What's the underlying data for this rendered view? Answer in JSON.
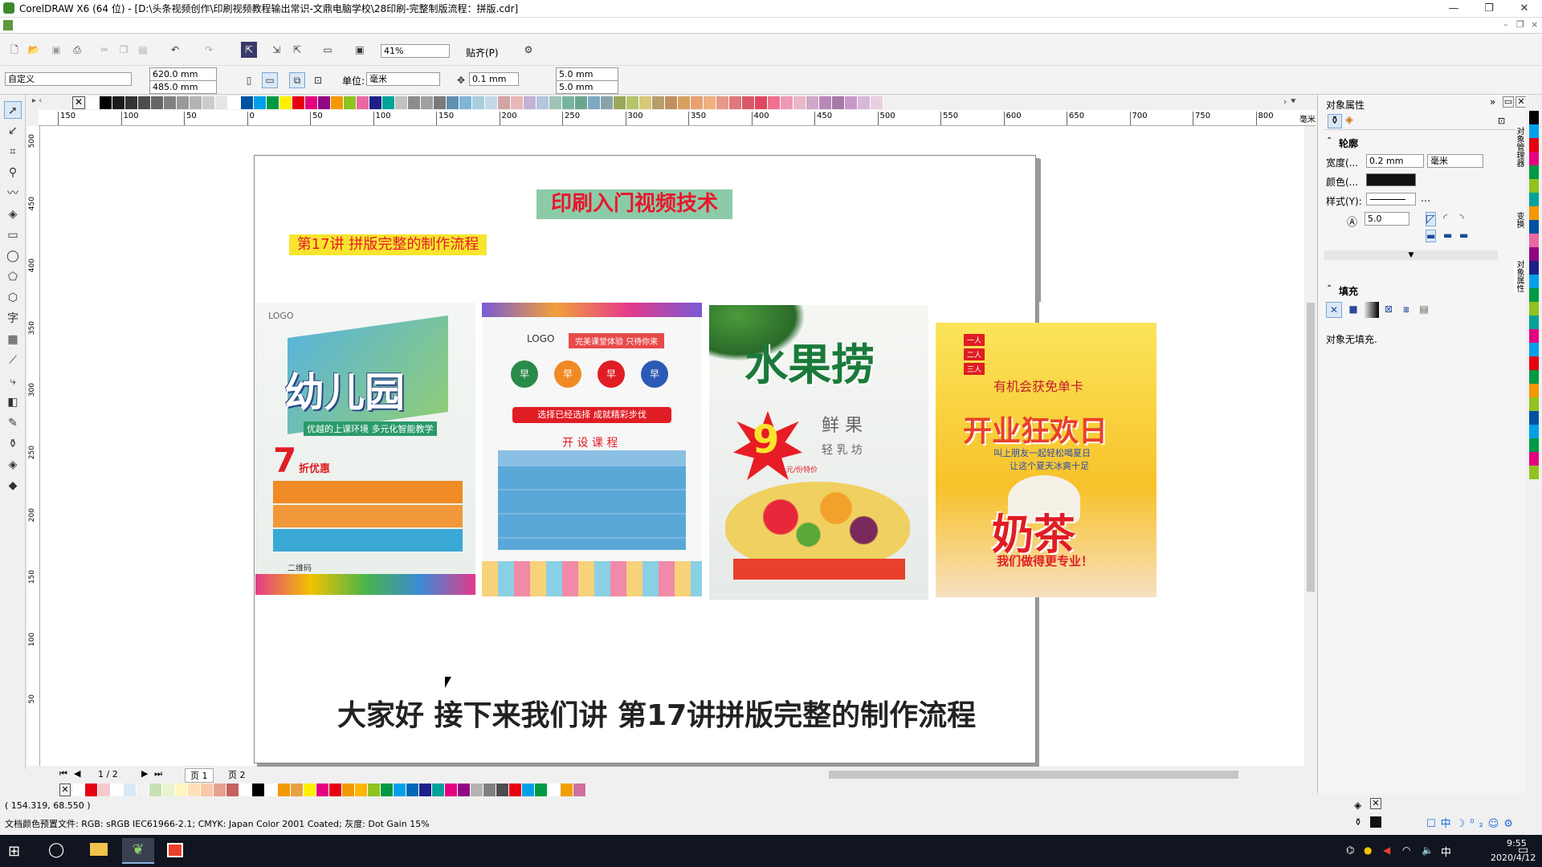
{
  "app": {
    "title": "CorelDRAW X6 (64 位) - [D:\\头条视频创作\\印刷视频教程输出常识-文鼎电脑学校\\28印刷-完整制版流程：拼版.cdr]",
    "window_controls": [
      "—",
      "❐",
      "✕"
    ],
    "doc_controls": [
      "–",
      "❐",
      "×"
    ]
  },
  "toolbar": {
    "zoom": "41%",
    "snap_label": "贴齐(P)",
    "preset": "自定义",
    "page_width": "620.0 mm",
    "page_height": "485.0 mm",
    "units_label": "单位:",
    "units_value": "毫米",
    "nudge": "0.1 mm",
    "dup_x": "5.0 mm",
    "dup_y": "5.0 mm"
  },
  "ruler": {
    "h_ticks": [
      "150",
      "100",
      "50",
      "0",
      "50",
      "100",
      "150",
      "200",
      "250",
      "300",
      "350",
      "400",
      "450",
      "500",
      "550",
      "600",
      "650",
      "700",
      "750",
      "800"
    ],
    "h_unit": "毫米",
    "v_ticks": [
      "500",
      "450",
      "400",
      "350",
      "300",
      "250",
      "200",
      "150",
      "100",
      "50"
    ]
  },
  "canvas": {
    "heading": "印刷入门视频技术",
    "subheading": "第17讲 拼版完整的制作流程",
    "subtitle": "大家好  接下来我们讲  第17讲拼版完整的制作流程"
  },
  "posters": [
    {
      "name": "kindergarten",
      "title": "幼儿园",
      "logo": "LOGO",
      "slogan": "优越的上课环境 多元化智能教学",
      "discount": "7",
      "discount_label": "折优惠",
      "footer": "二维码"
    },
    {
      "name": "course",
      "logo": "LOGO",
      "banner": "完美课堂体验 只待你来",
      "circles": [
        "早",
        "早",
        "早",
        "早"
      ],
      "cta": "选择已经选择 成就精彩步伐",
      "section": "开 设 课 程"
    },
    {
      "name": "fruit",
      "title": "水果捞",
      "badge": "9",
      "badge_unit": "元/份特价",
      "sub1": "鲜 果",
      "sub2": "轻 乳 坊"
    },
    {
      "name": "milktea",
      "offers": [
        "一人",
        "二人",
        "三人"
      ],
      "line": "有机会获免单卡",
      "title": "开业狂欢日",
      "sub": "叫上朋友一起轻松喝夏日",
      "sub2": "让这个夏天冰爽十足",
      "brand": "奶茶",
      "slogan": "我们做得更专业！"
    }
  ],
  "page_nav": {
    "count": "1 / 2",
    "tabs": [
      "页 1",
      "页 2"
    ]
  },
  "docker": {
    "title": "对象属性",
    "outline_section": "轮廓",
    "width_label": "宽度(...",
    "width_value": "0.2 mm",
    "unit_value": "毫米",
    "color_label": "颜色(...",
    "style_label": "样式(Y):",
    "miter_value": "5.0",
    "fill_section": "填充",
    "no_fill": "对象无填充.",
    "side_tabs": [
      "对象管理器",
      "变换",
      "对象属性"
    ]
  },
  "status": {
    "coords": "( 154.319, 68.550 )",
    "color_profile": "文档颜色预置文件: RGB: sRGB IEC61966-2.1; CMYK: Japan Color 2001 Coated; 灰度: Dot Gain 15%"
  },
  "taskbar": {
    "time": "9:55",
    "date": "2020/4/12",
    "tray": [
      "中",
      "ɡ",
      "⛢"
    ]
  },
  "palette": {
    "top": [
      "#ffffff",
      "#000000",
      "#1a1a1a",
      "#333333",
      "#4d4d4d",
      "#666666",
      "#808080",
      "#999999",
      "#b3b3b3",
      "#cccccc",
      "#e6e6e6",
      "#ffffff",
      "#0051a2",
      "#00a0e9",
      "#009944",
      "#fff100",
      "#e60012",
      "#e4007f",
      "#920783",
      "#f39800",
      "#8fc31f",
      "#ea68a2",
      "#1d2088",
      "#00a29a",
      "#c0c0c0",
      "#8c8c8c",
      "#a0a0a0",
      "#7a7a7a",
      "#5f8fb0",
      "#7fb5d5",
      "#a8cde0",
      "#c4d8e8",
      "#d1a3a4",
      "#e8b7b7",
      "#c1b2d6",
      "#b4c5e0",
      "#9fc5b6",
      "#77b4a0",
      "#6aa590",
      "#7ea9c2",
      "#8aa3a8",
      "#9aa85a",
      "#b5c46a",
      "#d6c978",
      "#b89d6b",
      "#c09060",
      "#d8a060",
      "#e8a070",
      "#f0b080",
      "#e89888",
      "#e07878",
      "#d85868",
      "#e04860",
      "#f07090",
      "#f098b8",
      "#e8b8c8",
      "#d0a8c8",
      "#b888b8",
      "#a878a8",
      "#c898c8",
      "#d8b8d8",
      "#e8d0e0"
    ],
    "bottom": [
      "#ffffff",
      "#e60012",
      "#f7c9cc",
      "#ffffff",
      "#d9e9f5",
      "#f2f2f2",
      "#c7e0b4",
      "#e8f3d0",
      "#fff6c0",
      "#ffe0b8",
      "#f8c8a8",
      "#e8a090",
      "#c86060",
      "#ffffff",
      "#000000",
      "#ffffff",
      "#f39800",
      "#e6a040",
      "#fff100",
      "#e4007f",
      "#e60012",
      "#f39800",
      "#ffb700",
      "#8fc31f",
      "#009944",
      "#00a0e9",
      "#0068b7",
      "#1d2088",
      "#00a29a",
      "#e4007f",
      "#920783",
      "#b3b3b3",
      "#808080",
      "#4d4d4d",
      "#e60012",
      "#00a0e9",
      "#009944",
      "#ffffff",
      "#f0a000",
      "#d070a0"
    ],
    "side": [
      "#000000",
      "#00a0e9",
      "#e60012",
      "#e4007f",
      "#009944",
      "#8fc31f",
      "#00a29a",
      "#f39800",
      "#0051a2",
      "#ea68a2",
      "#920783",
      "#1d2088",
      "#00a0e9",
      "#009944",
      "#8fc31f",
      "#00a29a",
      "#e4007f",
      "#00a0e9",
      "#e60012",
      "#009944",
      "#f39800",
      "#8fc31f",
      "#0051a2",
      "#00a0e9",
      "#009944",
      "#e4007f",
      "#8fc31f"
    ]
  }
}
